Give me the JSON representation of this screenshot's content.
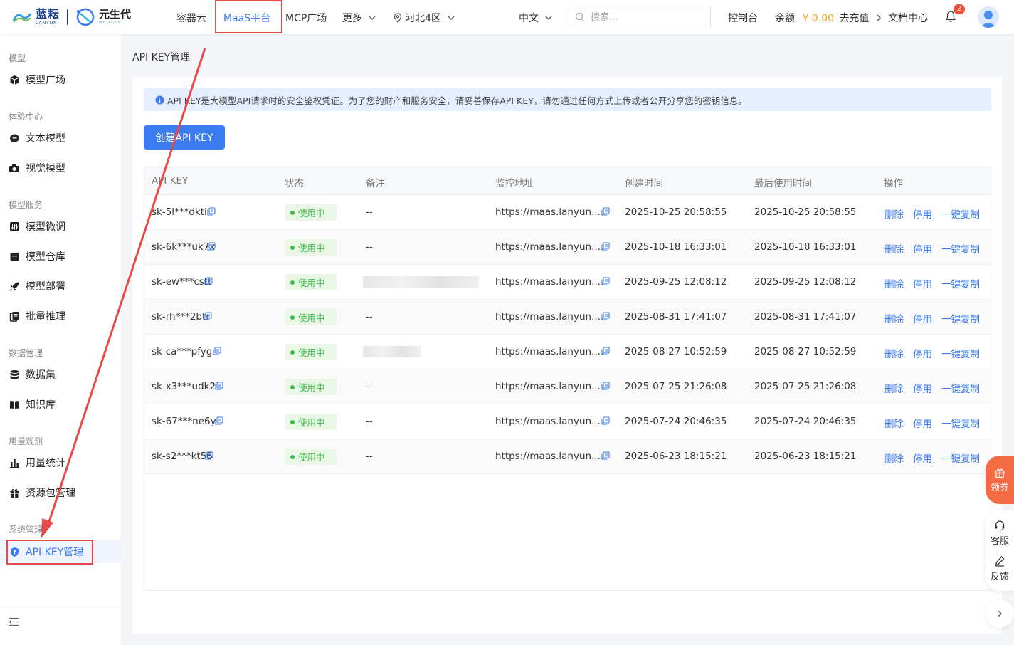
{
  "header": {
    "logo_lanyun_cn": "蓝耘",
    "logo_lanyun_en": "LANYUN",
    "logo_ys_cn": "元生代",
    "logo_ys_en": "METAGEN",
    "nav": {
      "container_cloud": "容器云",
      "maas": "MaaS平台",
      "mcp": "MCP广场",
      "more": "更多",
      "region": "河北4区"
    },
    "language": "中文",
    "search_placeholder": "搜索...",
    "console": "控制台",
    "balance_label": "余额",
    "balance_amount": "¥ 0.00",
    "recharge": "去充值",
    "docs": "文档中心",
    "notification_count": "2"
  },
  "sidebar": {
    "groups": {
      "model": "模型",
      "experience": "体验中心",
      "service": "模型服务",
      "data": "数据管理",
      "usage": "用量观测",
      "system": "系统管理"
    },
    "items": {
      "model_square": "模型广场",
      "text_model": "文本模型",
      "vision_model": "视觉模型",
      "finetune": "模型微调",
      "repo": "模型仓库",
      "deploy": "模型部署",
      "batch": "批量推理",
      "dataset": "数据集",
      "knowledge": "知识库",
      "usage_stats": "用量统计",
      "resource_pack": "资源包管理",
      "api_key": "API KEY管理"
    }
  },
  "main": {
    "title": "API KEY管理",
    "notice": "API KEY是大模型API请求时的安全鉴权凭证。为了您的财产和服务安全，请妥善保存API KEY，请勿通过任何方式上传或者公开分享您的密钥信息。",
    "create_button": "创建API KEY",
    "table": {
      "headers": {
        "key": "API KEY",
        "status": "状态",
        "remark": "备注",
        "monitor": "监控地址",
        "created": "创建时间",
        "last_used": "最后使用时间",
        "actions": "操作"
      },
      "actions": {
        "delete": "删除",
        "disable": "停用",
        "copy": "一键复制"
      },
      "rows": [
        {
          "key": "sk-5l***dkti",
          "status": "使用中",
          "remark": "--",
          "monitor": "https://maas.lanyun....",
          "created": "2025-10-25 20:58:55",
          "last_used": "2025-10-25 20:58:55"
        },
        {
          "key": "sk-6k***uk7x",
          "status": "使用中",
          "remark": "--",
          "monitor": "https://maas.lanyun....",
          "created": "2025-10-18 16:33:01",
          "last_used": "2025-10-18 16:33:01"
        },
        {
          "key": "sk-ew***cstt",
          "status": "使用中",
          "remark": "",
          "monitor": "https://maas.lanyun....",
          "created": "2025-09-25 12:08:12",
          "last_used": "2025-09-25 12:08:12"
        },
        {
          "key": "sk-rh***2btr",
          "status": "使用中",
          "remark": "--",
          "monitor": "https://maas.lanyun....",
          "created": "2025-08-31 17:41:07",
          "last_used": "2025-08-31 17:41:07"
        },
        {
          "key": "sk-ca***pfyg",
          "status": "使用中",
          "remark": "",
          "monitor": "https://maas.lanyun....",
          "created": "2025-08-27 10:52:59",
          "last_used": "2025-08-27 10:52:59"
        },
        {
          "key": "sk-x3***udk2",
          "status": "使用中",
          "remark": "--",
          "monitor": "https://maas.lanyun....",
          "created": "2025-07-25 21:26:08",
          "last_used": "2025-07-25 21:26:08"
        },
        {
          "key": "sk-67***ne6y",
          "status": "使用中",
          "remark": "--",
          "monitor": "https://maas.lanyun....",
          "created": "2025-07-24 20:46:35",
          "last_used": "2025-07-24 20:46:35"
        },
        {
          "key": "sk-s2***kt56",
          "status": "使用中",
          "remark": "--",
          "monitor": "https://maas.lanyun....",
          "created": "2025-06-23 18:15:21",
          "last_used": "2025-06-23 18:15:21"
        }
      ]
    }
  },
  "float": {
    "coupon": "领券",
    "service": "客服",
    "feedback": "反馈"
  },
  "colors": {
    "accent": "#3a7bef",
    "highlight_box": "#e84a4a",
    "status_green": "#3fb94a",
    "coupon_orange": "#f56b43"
  }
}
